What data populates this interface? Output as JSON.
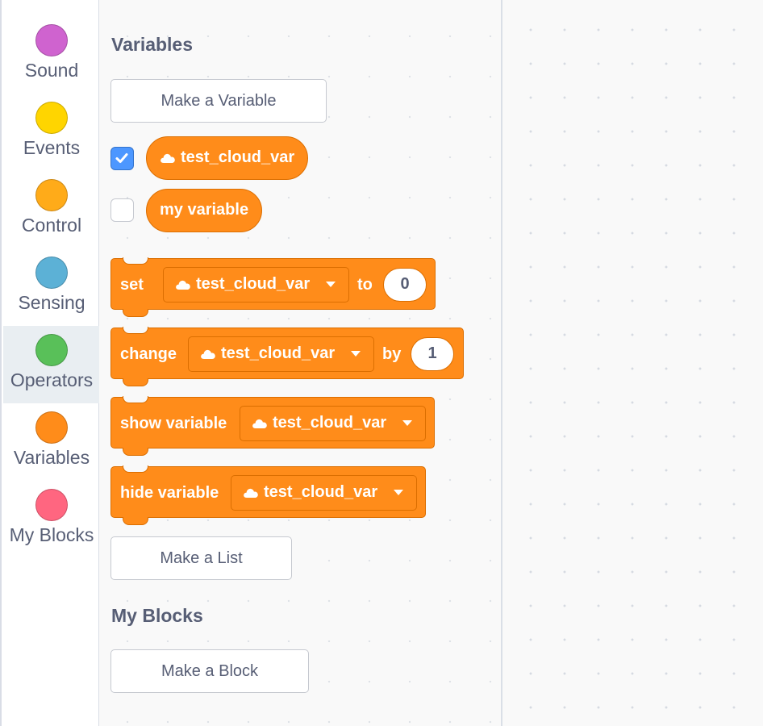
{
  "categories": [
    {
      "label": "Sound",
      "color": "#cf63cf"
    },
    {
      "label": "Events",
      "color": "#ffd500"
    },
    {
      "label": "Control",
      "color": "#ffab19"
    },
    {
      "label": "Sensing",
      "color": "#5cb1d6"
    },
    {
      "label": "Operators",
      "color": "#59c059"
    },
    {
      "label": "Variables",
      "color": "#ff8c1a"
    },
    {
      "label": "My Blocks",
      "color": "#ff6680"
    }
  ],
  "selected_category": "Operators",
  "flyout": {
    "variables_title": "Variables",
    "make_variable_button": "Make a Variable",
    "variables": [
      {
        "name": "test_cloud_var",
        "cloud": true,
        "checked": true
      },
      {
        "name": "my variable",
        "cloud": false,
        "checked": false
      }
    ],
    "blocks": {
      "set": {
        "label": "set",
        "variable": "test_cloud_var",
        "to_label": "to",
        "value": "0"
      },
      "change": {
        "label": "change",
        "variable": "test_cloud_var",
        "by_label": "by",
        "value": "1"
      },
      "show": {
        "label": "show variable",
        "variable": "test_cloud_var"
      },
      "hide": {
        "label": "hide variable",
        "variable": "test_cloud_var"
      }
    },
    "make_list_button": "Make a List",
    "my_blocks_title": "My Blocks",
    "make_block_button": "Make a Block"
  },
  "colors": {
    "variables_block": "#ff8c1a",
    "variables_block_border": "#db6e00",
    "text_primary": "#575e75",
    "checkbox_checked": "#4c97ff"
  },
  "icons": [
    "cloud-icon",
    "dropdown-arrow-icon",
    "checkmark-icon"
  ]
}
